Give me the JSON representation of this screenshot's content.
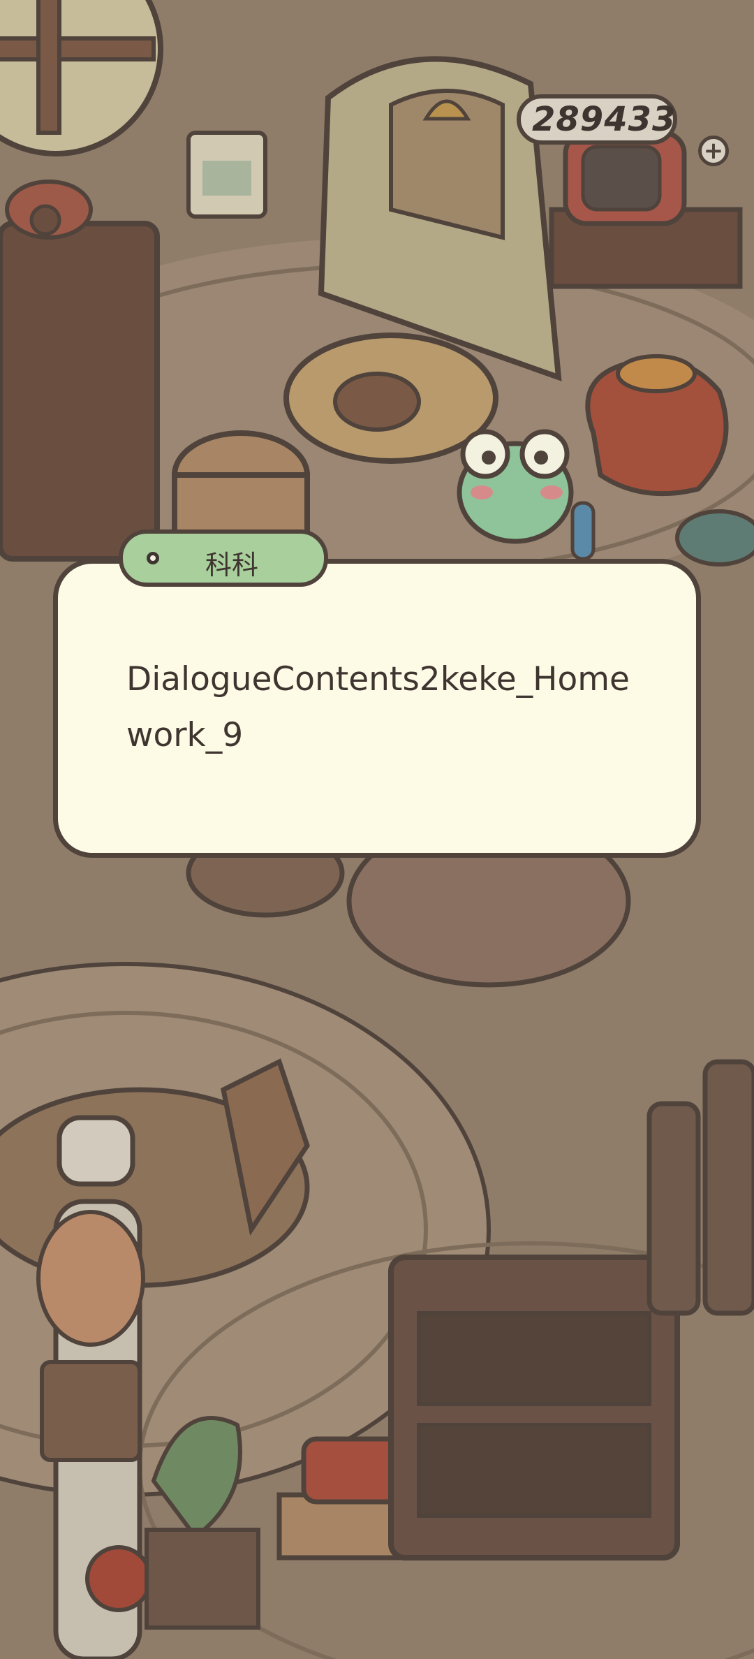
{
  "hud": {
    "coins": "289433",
    "add_symbol": "+"
  },
  "dialogue": {
    "speaker": "科科",
    "text": "DialogueContents2keke_Homework_9"
  },
  "colors": {
    "background": "#8f7d6a",
    "dialog_bg": "#fdfae6",
    "tag_green": "#a9cf9d",
    "outline": "#4f433b"
  }
}
